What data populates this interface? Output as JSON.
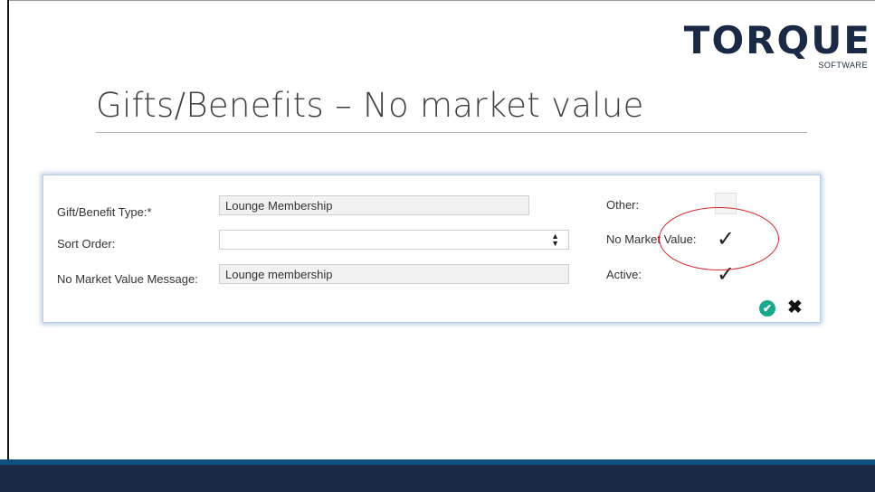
{
  "logo": {
    "main": "TORQUE",
    "sub": "SOFTWARE"
  },
  "page": {
    "title": "Gifts/Benefits – No market value"
  },
  "form": {
    "gift_benefit_type": {
      "label": "Gift/Benefit Type:*",
      "value": "Lounge Membership"
    },
    "sort_order": {
      "label": "Sort Order:",
      "value": ""
    },
    "no_market_value_message": {
      "label": "No Market Value Message:",
      "value": "Lounge membership"
    },
    "other": {
      "label": "Other:",
      "checked": false
    },
    "no_market_value": {
      "label": "No Market Value:",
      "checked": true
    },
    "active": {
      "label": "Active:",
      "checked": true
    },
    "checkmark_glyph": "✓",
    "save_glyph": "✔",
    "cancel_glyph": "✖",
    "spinner_up": "▲",
    "spinner_down": "▼"
  },
  "annotation": {
    "color": "#d42a2a"
  },
  "colors": {
    "footer": "#1a2a45",
    "accent": "#0f4f7e",
    "save": "#1aa78f",
    "logo": "#1b2a44"
  }
}
